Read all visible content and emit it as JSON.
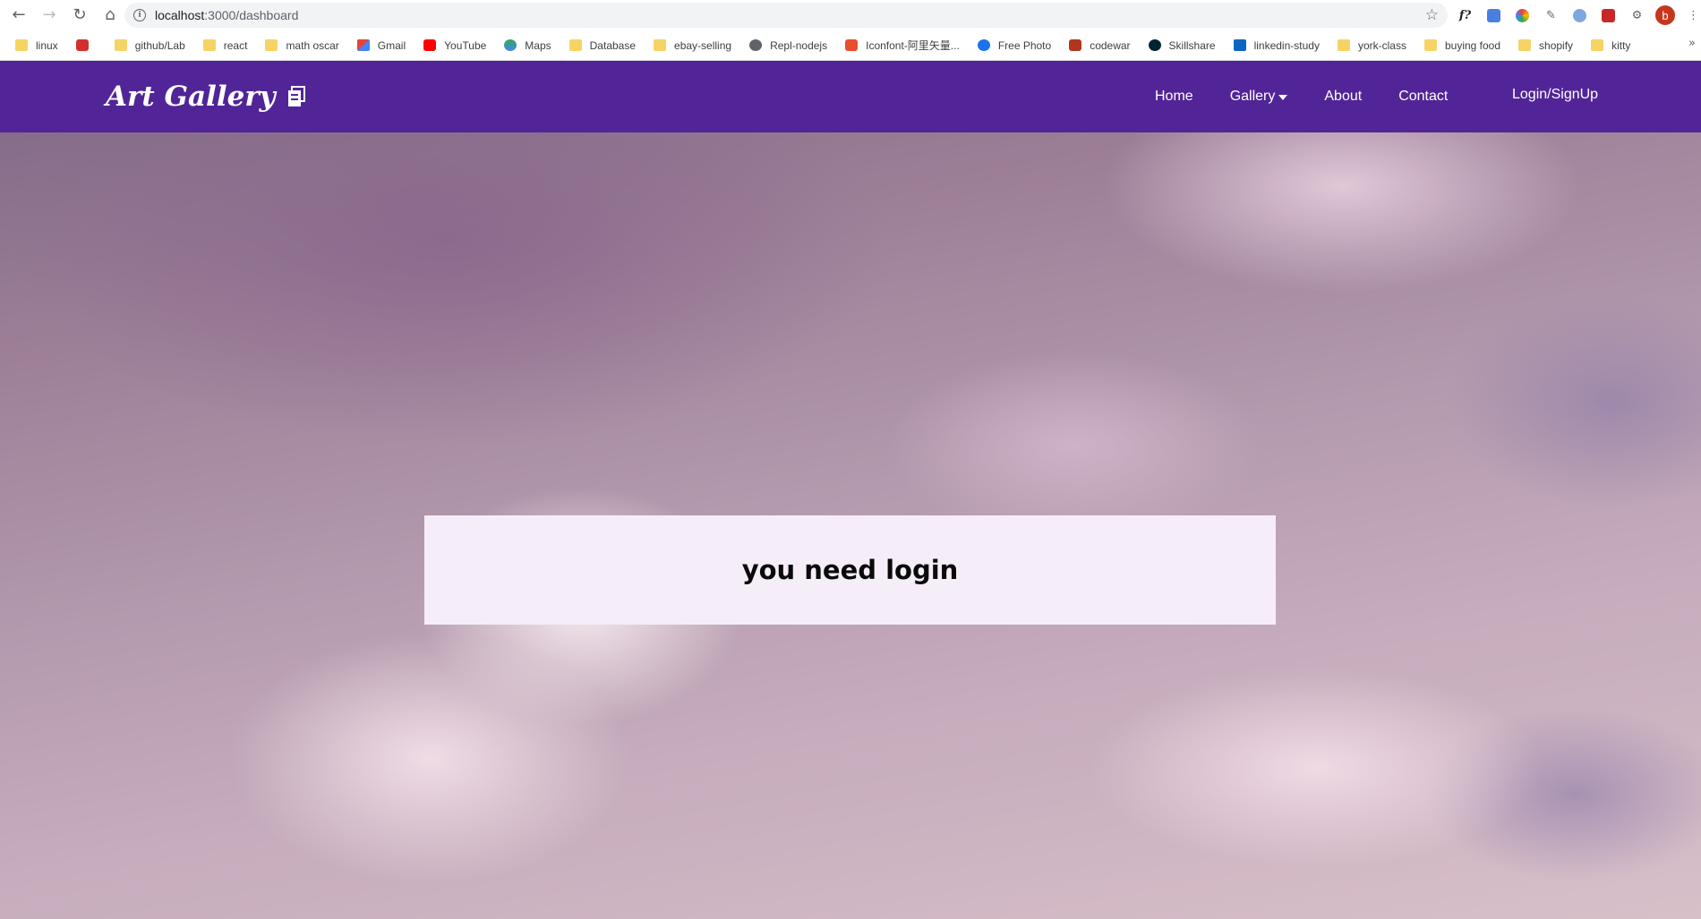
{
  "browser": {
    "url_host": "localhost",
    "url_rest": ":3000/dashboard",
    "bookmarks": [
      {
        "label": "linux",
        "icon": "folder-icon",
        "color": "#f6d365"
      },
      {
        "label": "",
        "icon": "oi-icon",
        "color": "#d32f2f"
      },
      {
        "label": "github/Lab",
        "icon": "folder-icon",
        "color": "#f6d365"
      },
      {
        "label": "react",
        "icon": "folder-icon",
        "color": "#f6d365"
      },
      {
        "label": "math oscar",
        "icon": "folder-icon",
        "color": "#f6d365"
      },
      {
        "label": "Gmail",
        "icon": "gmail-icon",
        "color": "#ea4335"
      },
      {
        "label": "YouTube",
        "icon": "youtube-icon",
        "color": "#ff0000"
      },
      {
        "label": "Maps",
        "icon": "maps-icon",
        "color": "#34a853"
      },
      {
        "label": "Database",
        "icon": "folder-icon",
        "color": "#f6d365"
      },
      {
        "label": "ebay-selling",
        "icon": "folder-icon",
        "color": "#f6d365"
      },
      {
        "label": "Repl-nodejs",
        "icon": "replit-icon",
        "color": "#5f6368"
      },
      {
        "label": "Iconfont-阿里矢量...",
        "icon": "iconfont-icon",
        "color": "#e94e2f"
      },
      {
        "label": "Free Photo",
        "icon": "freephoto-icon",
        "color": "#1a73e8"
      },
      {
        "label": "codewar",
        "icon": "codewars-icon",
        "color": "#b1361e"
      },
      {
        "label": "Skillshare",
        "icon": "skillshare-icon",
        "color": "#002333"
      },
      {
        "label": "linkedin-study",
        "icon": "linkedin-icon",
        "color": "#0a66c2"
      },
      {
        "label": "york-class",
        "icon": "folder-icon",
        "color": "#f6d365"
      },
      {
        "label": "buying food",
        "icon": "folder-icon",
        "color": "#f6d365"
      },
      {
        "label": "shopify",
        "icon": "folder-icon",
        "color": "#f6d365"
      },
      {
        "label": "kitty",
        "icon": "folder-icon",
        "color": "#f6d365"
      }
    ],
    "bookmarks_overflow": "»",
    "profile_initial": "b"
  },
  "site": {
    "brand": "Art Gallery",
    "nav": {
      "home": "Home",
      "gallery": "Gallery",
      "about": "About",
      "contact": "Contact",
      "login": "Login/SignUp"
    },
    "message": "you need login",
    "colors": {
      "navbar": "#512597",
      "message_box": "#f5eef9"
    }
  }
}
